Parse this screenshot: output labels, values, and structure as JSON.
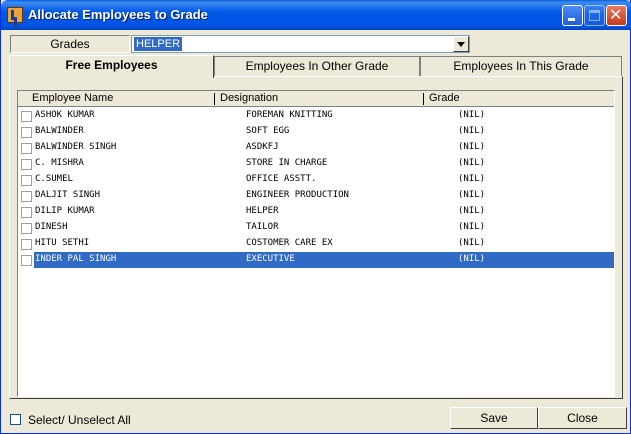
{
  "window": {
    "title": "Allocate Employees to Grade"
  },
  "grades": {
    "label": "Grades",
    "selected": "HELPER"
  },
  "tabs": [
    {
      "label": "Free Employees",
      "active": true
    },
    {
      "label": "Employees In Other Grade",
      "active": false
    },
    {
      "label": "Employees In This Grade",
      "active": false
    }
  ],
  "table": {
    "columns": [
      "Employee Name",
      "Designation",
      "Grade"
    ],
    "rows": [
      {
        "name": "ASHOK KUMAR",
        "designation": "FOREMAN KNITTING",
        "grade": "(NIL)"
      },
      {
        "name": "BALWINDER",
        "designation": "SOFT EGG",
        "grade": "(NIL)"
      },
      {
        "name": "BALWINDER SINGH",
        "designation": "ASDKFJ",
        "grade": "(NIL)"
      },
      {
        "name": "C. MISHRA",
        "designation": "STORE IN CHARGE",
        "grade": "(NIL)"
      },
      {
        "name": "C.SUMEL",
        "designation": "OFFICE ASSTT.",
        "grade": "(NIL)"
      },
      {
        "name": "DALJIT SINGH",
        "designation": "ENGINEER PRODUCTION",
        "grade": "(NIL)"
      },
      {
        "name": "DILIP KUMAR",
        "designation": "HELPER",
        "grade": "(NIL)"
      },
      {
        "name": "DINESH",
        "designation": "TAILOR",
        "grade": "(NIL)"
      },
      {
        "name": "HITU SETHI",
        "designation": "COSTOMER CARE EX",
        "grade": "(NIL)"
      },
      {
        "name": "INDER PAL SINGH",
        "designation": "EXECUTIVE",
        "grade": "(NIL)",
        "selected": true
      }
    ]
  },
  "footer": {
    "select_all_label": "Select/ Unselect All",
    "save_label": "Save",
    "close_label": "Close"
  }
}
